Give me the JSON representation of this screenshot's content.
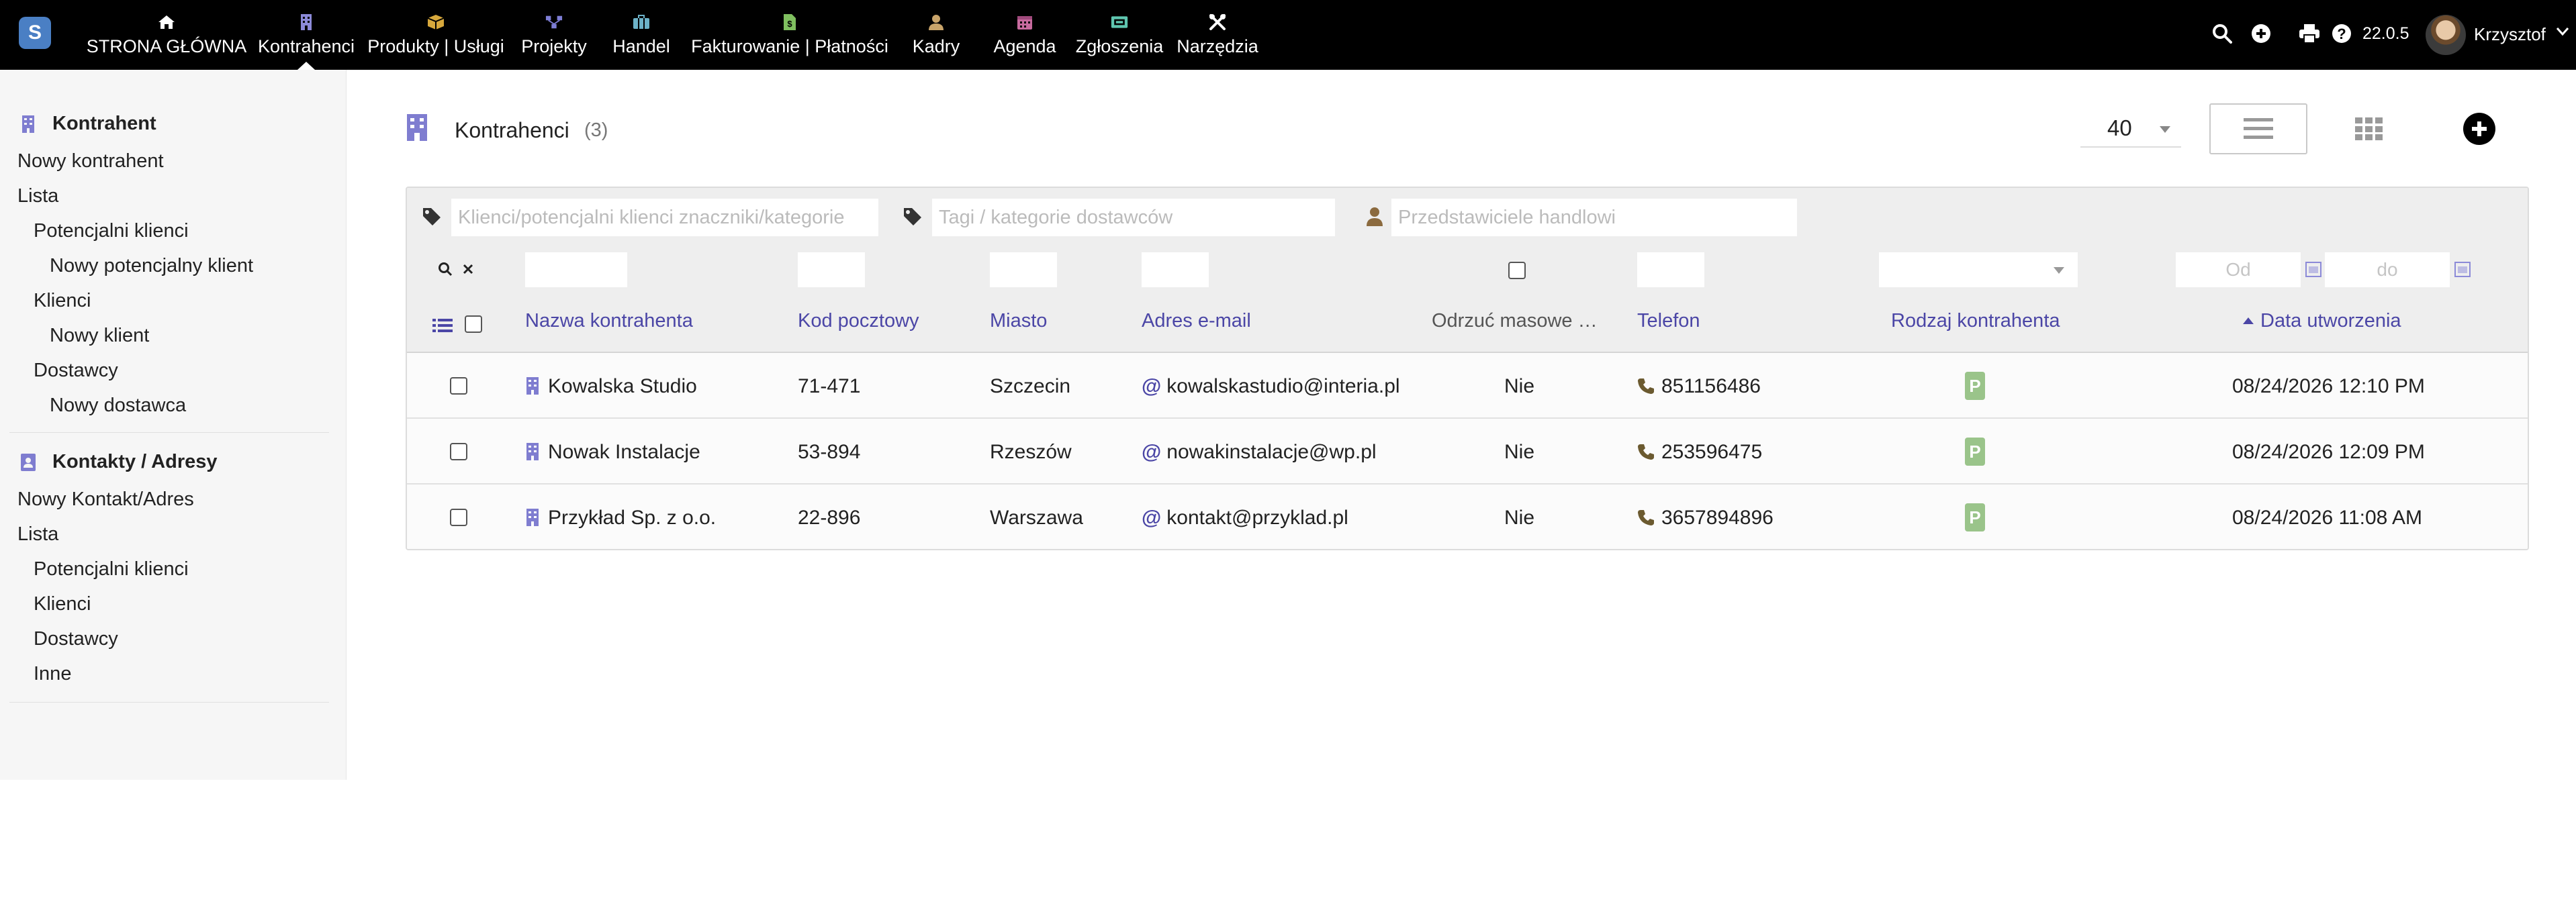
{
  "app": {
    "logo_letter": "S",
    "version": "22.0.5",
    "username": "Krzysztof"
  },
  "nav": [
    {
      "label": "STRONA GŁÓWNA",
      "icon": "home-icon",
      "color": "#ffffff"
    },
    {
      "label": "Kontrahenci",
      "icon": "building-icon",
      "color": "#8c8ad8"
    },
    {
      "label": "Produkty | Usługi",
      "icon": "box-icon",
      "color": "#d7a83c"
    },
    {
      "label": "Projekty",
      "icon": "project-network-icon",
      "color": "#7e7ed6"
    },
    {
      "label": "Handel",
      "icon": "briefcase-icon",
      "color": "#6cb2c8"
    },
    {
      "label": "Fakturowanie | Płatności",
      "icon": "invoice-icon",
      "color": "#7fbf5f"
    },
    {
      "label": "Kadry",
      "icon": "user-group-icon",
      "color": "#c9a46a"
    },
    {
      "label": "Agenda",
      "icon": "calendar-icon",
      "color": "#c76a9e"
    },
    {
      "label": "Zgłoszenia",
      "icon": "ticket-icon",
      "color": "#5fc6b0"
    },
    {
      "label": "Narzędzia",
      "icon": "tools-icon",
      "color": "#ffffff"
    }
  ],
  "sidebar": {
    "section1": {
      "title": "Kontrahent",
      "items": [
        "Nowy kontrahent",
        "Lista",
        "Potencjalni klienci",
        "Nowy potencjalny klient",
        "Klienci",
        "Nowy klient",
        "Dostawcy",
        "Nowy dostawca"
      ]
    },
    "section2": {
      "title": "Kontakty / Adresy",
      "items": [
        "Nowy Kontakt/Adres",
        "Lista",
        "Potencjalni klienci",
        "Klienci",
        "Dostawcy",
        "Inne"
      ]
    }
  },
  "main": {
    "title": "Kontrahenci",
    "count": "(3)",
    "per_page": "40"
  },
  "filters": {
    "customer_tags_placeholder": "Klienci/potencjalni klienci znaczniki/kategorie",
    "supplier_tags_placeholder": "Tagi / kategorie dostawców",
    "sales_reps_placeholder": "Przedstawiciele handlowi",
    "date_from_placeholder": "Od",
    "date_to_placeholder": "do"
  },
  "columns": {
    "name": "Nazwa kontrahenta",
    "zip": "Kod pocztowy",
    "city": "Miasto",
    "email": "Adres e-mail",
    "no_mass": "Odrzuć masowe …",
    "phone": "Telefon",
    "type": "Rodzaj kontrahenta",
    "created": "Data utworzenia"
  },
  "rows": [
    {
      "name": "Kowalska Studio",
      "zip": "71-471",
      "city": "Szczecin",
      "at": "@",
      "email": "kowalskastudio@interia.pl",
      "no_mass": "Nie",
      "phone": "851156486",
      "type": "P",
      "created": "08/24/2026 12:10 PM"
    },
    {
      "name": "Nowak Instalacje",
      "zip": "53-894",
      "city": "Rzeszów",
      "at": "@",
      "email": "nowakinstalacje@wp.pl",
      "no_mass": "Nie",
      "phone": "253596475",
      "type": "P",
      "created": "08/24/2026 12:09 PM"
    },
    {
      "name": "Przykład Sp. z o.o.",
      "zip": "22-896",
      "city": "Warszawa",
      "at": "@",
      "email": "kontakt@przyklad.pl",
      "no_mass": "Nie",
      "phone": "3657894896",
      "type": "P",
      "created": "08/24/2026 11:08 AM"
    }
  ],
  "colors": {
    "topbar": "#000000",
    "accent": "#4b46a6",
    "prospect_tag": "#9ac48a",
    "logo": "#4a7fc4"
  }
}
